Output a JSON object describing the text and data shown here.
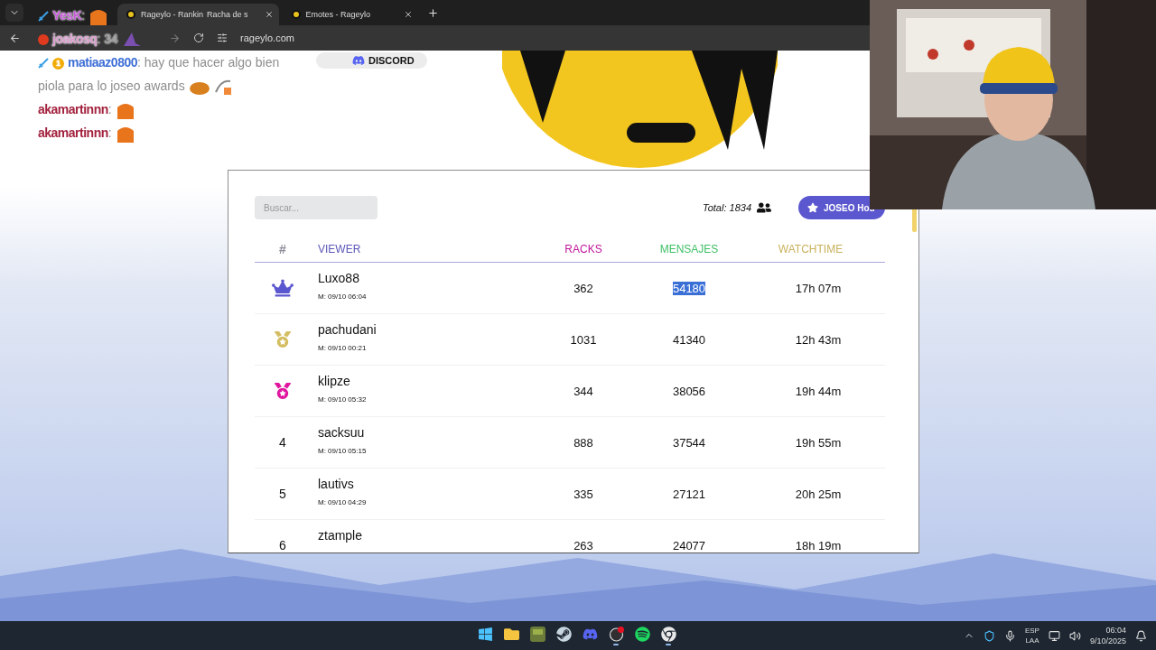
{
  "browser": {
    "tabs": [
      {
        "title_parts": [
          "Rageylo - Rankin",
          "Racha de s"
        ],
        "selected": true
      },
      {
        "title_parts": [
          "Emotes - Rageylo"
        ],
        "selected": false
      }
    ],
    "address": "rageylo.com"
  },
  "chat": [
    {
      "user": "YesK",
      "color": "#c45bd6",
      "message": ":",
      "badges": [
        {
          "kind": "sword"
        }
      ],
      "emotes": [
        {
          "kind": "box"
        }
      ]
    },
    {
      "user": "joakosq",
      "color": "#d99ccc",
      "message": ": 34",
      "badges": [
        {
          "kind": "stop"
        }
      ],
      "emotes": [
        {
          "kind": "hat"
        }
      ]
    },
    {
      "user": "matiaaz0800",
      "color": "#3e6fd6",
      "message": ": hay que hacer algo bien piola para lo joseo awards",
      "badges": [
        {
          "kind": "sword"
        },
        {
          "kind": "sub",
          "text": "1"
        }
      ],
      "emotes": [
        {
          "kind": "cat"
        },
        {
          "kind": "bow"
        }
      ]
    },
    {
      "user": "akamartinnn",
      "color": "#a3223e",
      "message": ":",
      "emotes": [
        {
          "kind": "box"
        }
      ]
    },
    {
      "user": "akamartinnn",
      "color": "#a3223e",
      "message": ":",
      "emotes": [
        {
          "kind": "box"
        }
      ]
    }
  ],
  "discord": {
    "label": "DISCORD"
  },
  "search": {
    "placeholder": "Buscar..."
  },
  "total": "Total: 1834",
  "feature_button": "JOSEO Hou",
  "columns": [
    {
      "label": "#",
      "color": "#8c8c99"
    },
    {
      "label": "VIEWER",
      "color": "#5b57b8"
    },
    {
      "label": "RACKS",
      "color": "#c0169a"
    },
    {
      "label": "MENSAJES",
      "color": "#3dbf63"
    },
    {
      "label": "WATCHTIME",
      "color": "#c9b15c"
    }
  ],
  "rows": [
    {
      "rank": {
        "kind": "crown",
        "color": "#5b57cf"
      },
      "name": "Luxo88",
      "date": "M: 09/10 06:04",
      "racks": "362",
      "mensajes": "54180",
      "mensajes_selected": true,
      "watchtime": "17h 07m"
    },
    {
      "rank": {
        "kind": "medal",
        "color": "#d4bd62"
      },
      "name": "pachudani",
      "date": "M: 09/10 00:21",
      "racks": "1031",
      "mensajes": "41340",
      "mensajes_selected": false,
      "watchtime": "12h 43m"
    },
    {
      "rank": {
        "kind": "medal",
        "color": "#e0169e"
      },
      "name": "klipze",
      "date": "M: 09/10 05:32",
      "racks": "344",
      "mensajes": "38056",
      "mensajes_selected": false,
      "watchtime": "19h 44m"
    },
    {
      "rank": {
        "kind": "number",
        "text": "4"
      },
      "name": "sacksuu",
      "date": "M: 09/10 05:15",
      "racks": "888",
      "mensajes": "37544",
      "mensajes_selected": false,
      "watchtime": "19h 55m"
    },
    {
      "rank": {
        "kind": "number",
        "text": "5"
      },
      "name": "lautivs",
      "date": "M: 09/10 04:29",
      "racks": "335",
      "mensajes": "27121",
      "mensajes_selected": false,
      "watchtime": "20h 25m"
    },
    {
      "rank": {
        "kind": "number",
        "text": "6"
      },
      "name": "ztample",
      "racks": "263",
      "mensajes": "24077",
      "mensajes_selected": false,
      "watchtime": "18h 19m"
    }
  ],
  "taskbar": {
    "apps": [
      {
        "kind": "windows",
        "running": false
      },
      {
        "kind": "folder",
        "running": false
      },
      {
        "kind": "game",
        "running": false
      },
      {
        "kind": "steam",
        "running": false
      },
      {
        "kind": "discord",
        "running": false
      },
      {
        "kind": "obs",
        "running": true
      },
      {
        "kind": "spotify",
        "running": false
      },
      {
        "kind": "chrome",
        "running": true
      }
    ],
    "language": [
      "ESP",
      "LAA"
    ],
    "time": "06:04",
    "date": "9/10/2025"
  }
}
